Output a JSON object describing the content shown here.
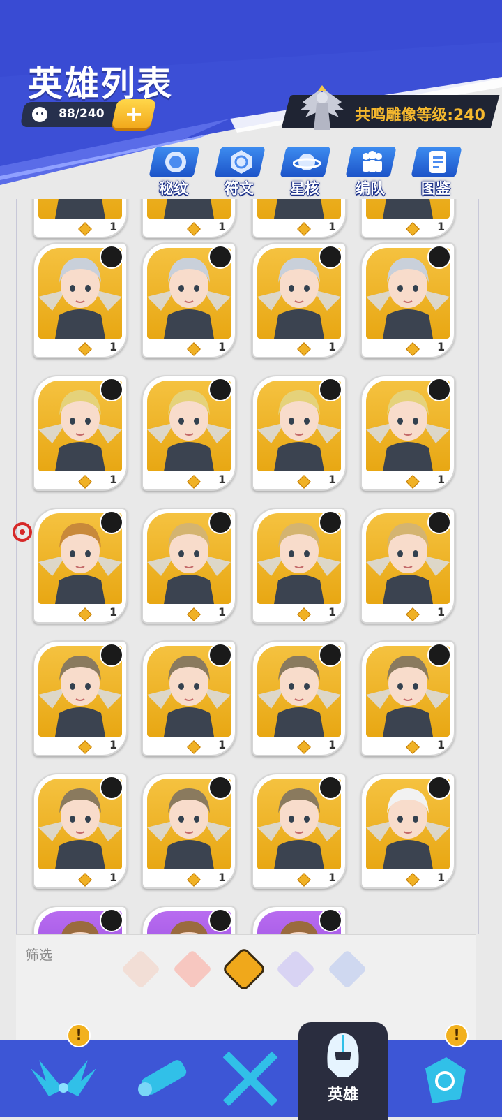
{
  "header": {
    "title": "英雄列表",
    "hero_count": "88/240",
    "plus_label": "+",
    "resonance_label": "共鸣雕像等级:240"
  },
  "tabs": [
    {
      "label": "秘纹",
      "icon": "rune-icon"
    },
    {
      "label": "符文",
      "icon": "glyph-icon"
    },
    {
      "label": "星核",
      "icon": "planet-icon"
    },
    {
      "label": "编队",
      "icon": "team-icon"
    },
    {
      "label": "图鉴",
      "icon": "book-icon"
    }
  ],
  "cards": {
    "level": "1",
    "rows": [
      {
        "hero": "cropped-top",
        "class": "tank-icon"
      },
      {
        "hero": "silver-hair-knight",
        "class": "shield-icon"
      },
      {
        "hero": "blonde-winged-knight",
        "class": "mage-icon"
      },
      {
        "hero": "crowned-archer,bob-hair-archer",
        "class": "archer-icon"
      },
      {
        "hero": "topknot-archer",
        "class": "archer-icon"
      },
      {
        "hero": "topknot-archer,white-hair-assassin",
        "class": "archer-icon"
      },
      {
        "hero": "purple-cards",
        "class": "mixed-icon"
      }
    ]
  },
  "filter": {
    "label": "筛选",
    "options": [
      "all-classes",
      "star",
      "wings",
      "horns",
      "wave"
    ],
    "selected": "wings"
  },
  "nav": {
    "items": [
      "wings",
      "scroll",
      "swords",
      "hero",
      "stone"
    ],
    "active_label": "英雄",
    "alert_symbol": "!"
  },
  "colors": {
    "header_blue": "#3d4fd4",
    "accent_gold": "#f5b82e",
    "card_gold": "#e8a713"
  }
}
